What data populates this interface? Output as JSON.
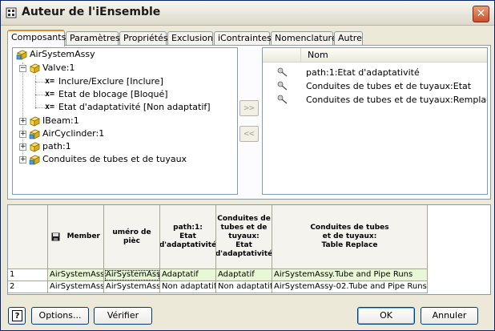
{
  "window": {
    "title": "Auteur de l'iEnsemble",
    "close": "✕"
  },
  "tabs": [
    "Composants",
    "Paramètres",
    "Propriétés",
    "Exclusion",
    "iContraintes",
    "Nomenclature",
    "Autre"
  ],
  "tree": {
    "root": "AirSystemAssy",
    "valve": "Valve:1",
    "valve_children": [
      {
        "prefix": "x=",
        "label": "Inclure/Exclure [Inclure]"
      },
      {
        "prefix": "x=",
        "label": "Etat de blocage [Bloqué]"
      },
      {
        "prefix": "x=",
        "label": "Etat d'adaptativité [Non adaptatif]"
      }
    ],
    "others": [
      "IBeam:1",
      "AirCyclinder:1",
      "path:1",
      "Conduites de tubes et de tuyaux"
    ],
    "expand_plus": "+",
    "expand_minus": "−"
  },
  "move": {
    "add": ">>",
    "remove": "<<"
  },
  "list": {
    "header": "Nom",
    "items": [
      "path:1:Etat d'adaptativité",
      "Conduites de tubes et de tuyaux:Etat",
      "Conduites de tubes et de tuyaux:Remplacement"
    ]
  },
  "grid": {
    "headers": {
      "member": "Member",
      "part_number": "uméro de pièc",
      "path_state": "path:1:\nEtat\nd'adaptativité",
      "tubes_state": "Conduites de\ntubes et de\ntuyaux:\nEtat\nd'adaptativité",
      "tubes_replace": "Conduites de tubes\net de tuyaux:\nTable Replace"
    },
    "rows": [
      {
        "num": "1",
        "member": "AirSystemAss",
        "part": "AirSystemAss",
        "path": "Adaptatif",
        "tubes": "Adaptatif",
        "replace": "AirSystemAssy.Tube and Pipe Runs"
      },
      {
        "num": "2",
        "member": "AirSystemAss",
        "part": "AirSystemAss",
        "path": "Non adaptatif",
        "tubes": "Non adaptatif",
        "replace": "AirSystemAssy-02.Tube and Pipe Runs"
      }
    ]
  },
  "buttons": {
    "help": "?",
    "options": "Options...",
    "verify": "Vérifier",
    "ok": "OK",
    "cancel": "Annuler"
  },
  "colors": {
    "accent_tab": "#e68b2c",
    "green_cell": "#e8f8d6",
    "folder": "#f5d342"
  }
}
